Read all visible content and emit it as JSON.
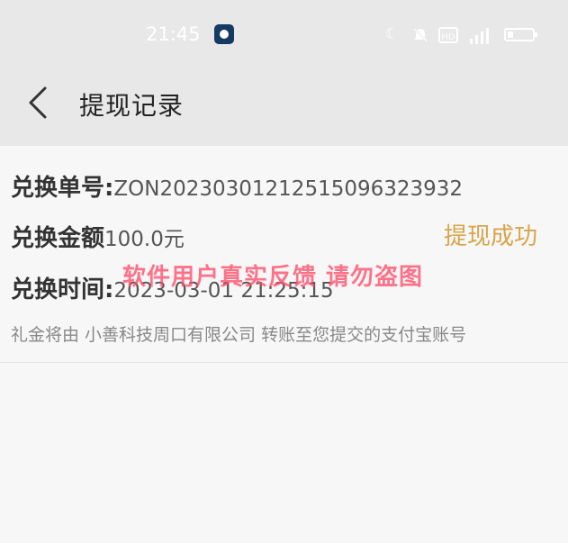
{
  "status_bar": {
    "time": "21:45",
    "icons": [
      "moon-icon",
      "bell-muted-icon",
      "hd-icon",
      "signal-icon",
      "battery-icon"
    ]
  },
  "header": {
    "title": "提现记录"
  },
  "record": {
    "order_label": "兑换单号:",
    "order_value": "ZON20230301212515096323932",
    "amount_label": "兑换金额",
    "amount_value": "100.0元",
    "status": "提现成功",
    "time_label": "兑换时间:",
    "time_value": "2023-03-01 21:25:15",
    "note": "礼金将由 小善科技周口有限公司 转账至您提交的支付宝账号"
  },
  "watermark": "软件用户真实反馈  请勿盗图",
  "colors": {
    "status": "#d9a44a",
    "watermark": "#ff4d6a",
    "header_bg": "#e8e8e8"
  }
}
